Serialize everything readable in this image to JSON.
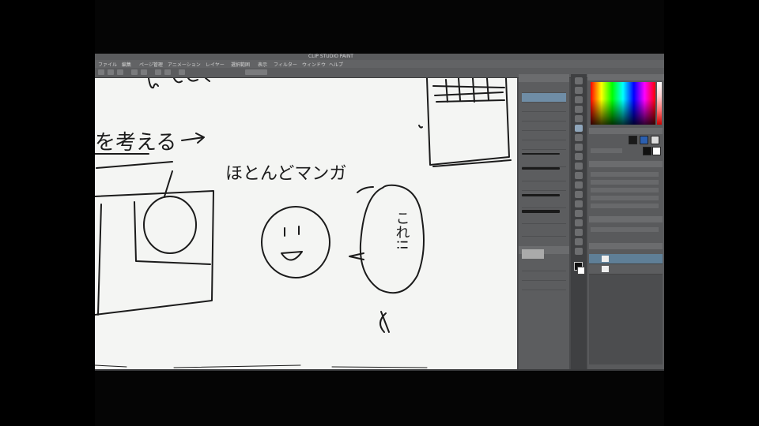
{
  "window": {
    "title": "CLIP STUDIO PAINT"
  },
  "menu": {
    "items": [
      "ファイル",
      "編集",
      "ページ管理",
      "アニメーション",
      "レイヤー",
      "選択範囲",
      "表示",
      "フィルター",
      "ウィンドウ",
      "ヘルプ"
    ]
  },
  "canvas": {
    "texts": {
      "note_left": "を考える",
      "heading": "ほとんどマンガ",
      "speech_vertical": "これ!!"
    }
  },
  "brush_panel": {
    "labels": [
      "",
      "",
      "",
      "",
      "",
      "",
      "",
      "",
      "",
      "",
      "",
      "",
      "",
      "",
      "",
      ""
    ]
  },
  "colors": {
    "canvas_bg": "#f4f5f3",
    "ink": "#1b1b1b",
    "ui_dark": "#4a4b4d",
    "selected": "#5f7f97"
  }
}
